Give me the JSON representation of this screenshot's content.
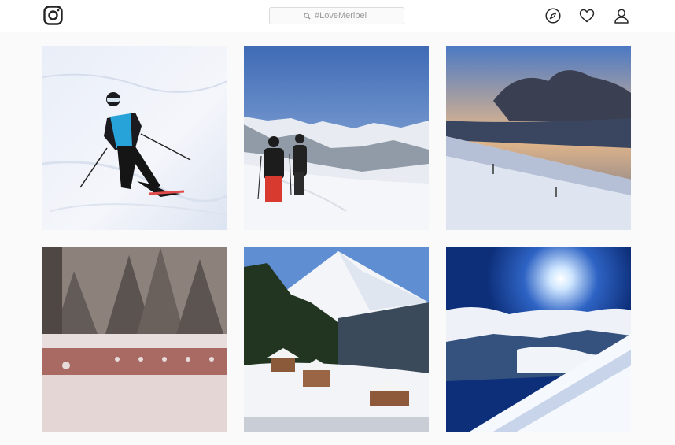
{
  "header": {
    "logo_icon": "instagram-logo-icon",
    "search": {
      "placeholder": "#LoveMeribel",
      "value": "",
      "icon": "search-icon"
    },
    "nav": [
      {
        "name": "explore",
        "icon": "compass-icon"
      },
      {
        "name": "activity",
        "icon": "heart-icon"
      },
      {
        "name": "profile",
        "icon": "person-icon"
      }
    ]
  },
  "posts": [
    {
      "subject": "skier-blue-jacket"
    },
    {
      "subject": "two-skiers-mountain-view"
    },
    {
      "subject": "sunset-clouds-ski-slope"
    },
    {
      "subject": "snowy-balcony-forest"
    },
    {
      "subject": "ski-resort-village"
    },
    {
      "subject": "sun-over-cloud-sea"
    }
  ],
  "colors": {
    "background": "#fafafa",
    "header_bg": "#ffffff",
    "border": "#e6e6e6",
    "icon": "#262626"
  }
}
